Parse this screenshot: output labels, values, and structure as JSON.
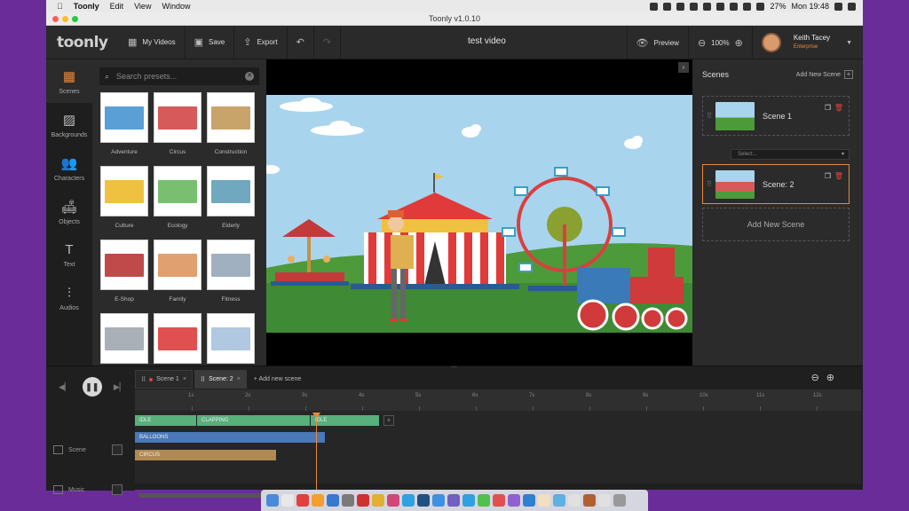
{
  "menubar": {
    "app": "Toonly",
    "items": [
      "Edit",
      "View",
      "Window"
    ],
    "battery": "27%",
    "clock": "Mon 19:48"
  },
  "window": {
    "title": "Toonly v1.0.10"
  },
  "toolbar": {
    "logo": "toonly",
    "my_videos": "My Videos",
    "save": "Save",
    "export": "Export",
    "doc_title": "test video",
    "preview": "Preview",
    "zoom": "100%",
    "user_name": "Keith Tacey",
    "user_plan": "Enterprise"
  },
  "rail": [
    {
      "label": "Scenes",
      "icon": "scenes-icon",
      "glyph": "▦"
    },
    {
      "label": "Backgrounds",
      "icon": "backgrounds-icon",
      "glyph": "▨"
    },
    {
      "label": "Characters",
      "icon": "characters-icon",
      "glyph": "👥"
    },
    {
      "label": "Objects",
      "icon": "objects-icon",
      "glyph": "🛋"
    },
    {
      "label": "Text",
      "icon": "text-icon",
      "glyph": "T"
    },
    {
      "label": "Audios",
      "icon": "audios-icon",
      "glyph": "⫶"
    }
  ],
  "presets": {
    "search_placeholder": "Search presets...",
    "items": [
      {
        "label": "Adventure",
        "color": "#5a9fd6"
      },
      {
        "label": "Circus",
        "color": "#d65a5a"
      },
      {
        "label": "Construction",
        "color": "#c8a36a"
      },
      {
        "label": "Culture",
        "color": "#f0c040"
      },
      {
        "label": "Ecology",
        "color": "#78c070"
      },
      {
        "label": "Elderly",
        "color": "#70a8c0"
      },
      {
        "label": "E-Shop",
        "color": "#c04a4a"
      },
      {
        "label": "Family",
        "color": "#e0a070"
      },
      {
        "label": "Fitness",
        "color": "#a0b0c0"
      },
      {
        "label": "",
        "color": "#aab0b8"
      },
      {
        "label": "",
        "color": "#e05050"
      },
      {
        "label": "",
        "color": "#b0c8e0"
      }
    ]
  },
  "scenes_panel": {
    "title": "Scenes",
    "add_label": "Add New Scene",
    "scenes": [
      {
        "name": "Scene 1",
        "color": "#7ec0e8"
      },
      {
        "name": "Scene: 2",
        "color": "#d65a5a"
      }
    ],
    "transition_placeholder": "Select...",
    "add_big": "Add New Scene"
  },
  "timeline": {
    "tabs": [
      {
        "label": "Scene 1"
      },
      {
        "label": "Scene: 2"
      }
    ],
    "add_tab": "Add new scene",
    "ticks": [
      "1s",
      "2s",
      "3s",
      "4s",
      "5s",
      "6s",
      "7s",
      "8s",
      "9s",
      "10s",
      "11s",
      "12s"
    ],
    "rows": [
      {
        "label": "Scene"
      },
      {
        "label": "Music"
      }
    ],
    "clips": [
      {
        "label": "IDLE",
        "color": "#58b07c"
      },
      {
        "label": "CLAPPING",
        "color": "#58b07c"
      },
      {
        "label": "IDLE",
        "color": "#58b07c"
      },
      {
        "label": "BALLOONS",
        "color": "#4a78b8"
      },
      {
        "label": "CIRCUS",
        "color": "#b08a50"
      }
    ]
  }
}
